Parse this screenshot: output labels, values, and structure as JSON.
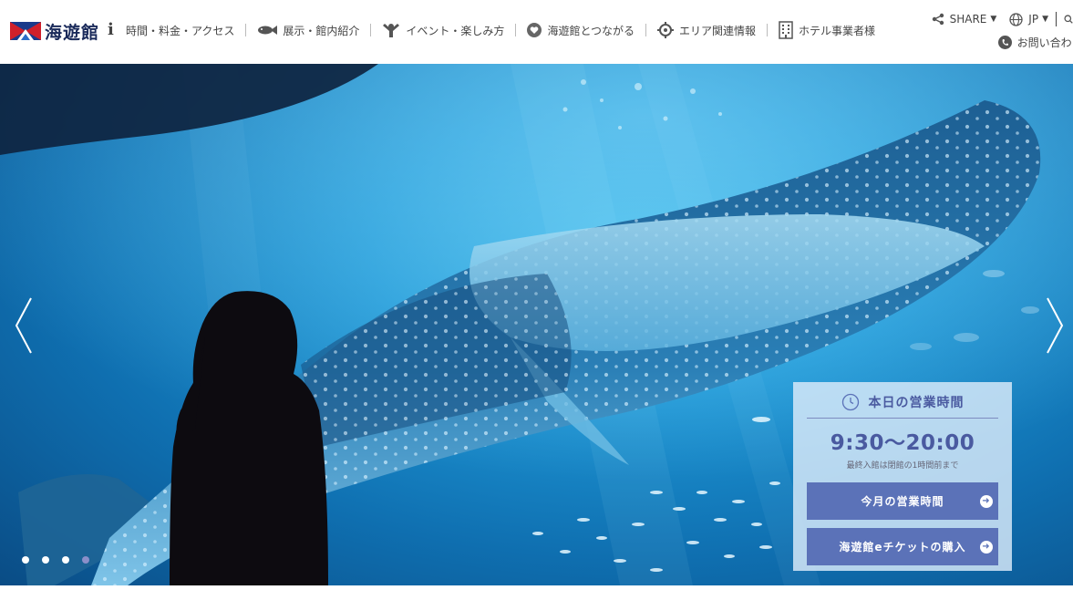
{
  "header": {
    "logo_text": "海遊館",
    "info_glyph": "i",
    "nav": [
      {
        "label": "時間・料金・アクセス",
        "icon": "none"
      },
      {
        "label": "展示・館内紹介",
        "icon": "fish-icon"
      },
      {
        "label": "イベント・楽しみ方",
        "icon": "person-icon"
      },
      {
        "label": "海遊館とつながる",
        "icon": "heart-icon"
      },
      {
        "label": "エリア関連情報",
        "icon": "location-target-icon"
      },
      {
        "label": "ホテル事業者様",
        "icon": "building-icon"
      }
    ],
    "share_label": "SHARE",
    "lang_label": "JP",
    "contact_label": "お問い合わ"
  },
  "hero": {
    "slides": 4,
    "active_slide": 4
  },
  "hours": {
    "title": "本日の営業時間",
    "time": "9:30〜20:00",
    "note": "最終入館は閉館の1時間前まで",
    "btn_month": "今月の営業時間",
    "btn_ticket": "海遊館eチケットの購入"
  },
  "colors": {
    "accent": "#5b72b8",
    "accent_text": "#4a5aa0",
    "dot_active": "#8b8fc9",
    "logo_navy": "#1a2a5a",
    "logo_red": "#d0202a"
  }
}
